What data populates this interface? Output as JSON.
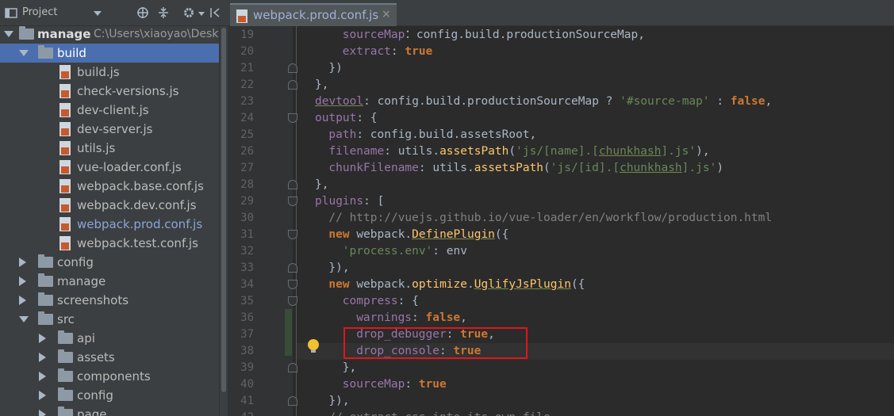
{
  "project_panel": {
    "title": "Project",
    "root": {
      "name": "manage",
      "path": "C:\\Users\\xiaoyao\\Deskt"
    },
    "tree": [
      {
        "label": "build",
        "type": "folder",
        "expanded": true,
        "depth": 1,
        "selected": true
      },
      {
        "label": "build.js",
        "type": "js",
        "depth": 2
      },
      {
        "label": "check-versions.js",
        "type": "js",
        "depth": 2
      },
      {
        "label": "dev-client.js",
        "type": "js",
        "depth": 2
      },
      {
        "label": "dev-server.js",
        "type": "js",
        "depth": 2
      },
      {
        "label": "utils.js",
        "type": "js",
        "depth": 2
      },
      {
        "label": "vue-loader.conf.js",
        "type": "js",
        "depth": 2
      },
      {
        "label": "webpack.base.conf.js",
        "type": "js",
        "depth": 2
      },
      {
        "label": "webpack.dev.conf.js",
        "type": "js",
        "depth": 2
      },
      {
        "label": "webpack.prod.conf.js",
        "type": "js",
        "depth": 2,
        "active": true
      },
      {
        "label": "webpack.test.conf.js",
        "type": "js",
        "depth": 2
      },
      {
        "label": "config",
        "type": "folder",
        "expanded": false,
        "depth": 1
      },
      {
        "label": "manage",
        "type": "folder",
        "expanded": false,
        "depth": 1
      },
      {
        "label": "screenshots",
        "type": "folder",
        "expanded": false,
        "depth": 1
      },
      {
        "label": "src",
        "type": "folder",
        "expanded": true,
        "depth": 1
      },
      {
        "label": "api",
        "type": "folder",
        "expanded": false,
        "depth": 2
      },
      {
        "label": "assets",
        "type": "folder",
        "expanded": false,
        "depth": 2
      },
      {
        "label": "components",
        "type": "folder",
        "expanded": false,
        "depth": 2
      },
      {
        "label": "config",
        "type": "folder",
        "expanded": false,
        "depth": 2
      },
      {
        "label": "page",
        "type": "folder",
        "expanded": false,
        "depth": 2
      }
    ]
  },
  "editor": {
    "tab": {
      "label": "webpack.prod.conf.js",
      "close": "×"
    },
    "lines": [
      {
        "n": "19",
        "indent": 4,
        "t": [
          [
            "p",
            "sourceMap"
          ],
          [
            "",
            "："
          ],
          [
            "",
            "config.build.productionSourceMap,"
          ]
        ]
      },
      {
        "n": "20",
        "indent": 4,
        "t": [
          [
            "p",
            "extract"
          ],
          [
            "",
            ": "
          ],
          [
            "k",
            "true"
          ]
        ]
      },
      {
        "n": "21",
        "indent": 2,
        "t": [
          [
            "",
            "})"
          ]
        ]
      },
      {
        "n": "22",
        "indent": 0,
        "t": [
          [
            "",
            "},"
          ]
        ]
      },
      {
        "n": "23",
        "indent": 0,
        "t": [
          [
            "pu",
            "devtool"
          ],
          [
            "",
            ": config.build.productionSourceMap ? "
          ],
          [
            "s",
            "'#source-map'"
          ],
          [
            "",
            " : "
          ],
          [
            "k",
            "false"
          ],
          [
            "",
            ","
          ]
        ]
      },
      {
        "n": "24",
        "indent": 0,
        "t": [
          [
            "p",
            "output"
          ],
          [
            "",
            ": {"
          ]
        ]
      },
      {
        "n": "25",
        "indent": 2,
        "t": [
          [
            "p",
            "path"
          ],
          [
            "",
            ": config.build.assetsRoot,"
          ]
        ]
      },
      {
        "n": "26",
        "indent": 2,
        "t": [
          [
            "p",
            "filename"
          ],
          [
            "",
            ": utils."
          ],
          [
            "f",
            "assetsPath"
          ],
          [
            "",
            "("
          ],
          [
            "s",
            "'js/[name].["
          ],
          [
            "su",
            "chunkhash"
          ],
          [
            "s",
            "].js'"
          ],
          [
            "",
            "),"
          ]
        ]
      },
      {
        "n": "27",
        "indent": 2,
        "t": [
          [
            "p",
            "chunkFilename"
          ],
          [
            "",
            ": utils."
          ],
          [
            "f",
            "assetsPath"
          ],
          [
            "",
            "("
          ],
          [
            "s",
            "'js/[id].["
          ],
          [
            "su",
            "chunkhash"
          ],
          [
            "s",
            "].js'"
          ],
          [
            "",
            ")"
          ]
        ]
      },
      {
        "n": "28",
        "indent": 0,
        "t": [
          [
            "",
            "},"
          ]
        ]
      },
      {
        "n": "29",
        "indent": 0,
        "t": [
          [
            "p",
            "plugins"
          ],
          [
            "",
            ": ["
          ]
        ]
      },
      {
        "n": "30",
        "indent": 2,
        "t": [
          [
            "c",
            "// http://vuejs.github.io/vue-loader/en/workflow/production.html"
          ]
        ]
      },
      {
        "n": "31",
        "indent": 2,
        "t": [
          [
            "k",
            "new "
          ],
          [
            "",
            "webpack."
          ],
          [
            "fu",
            "DefinePlugin"
          ],
          [
            "",
            "({"
          ]
        ]
      },
      {
        "n": "32",
        "indent": 4,
        "t": [
          [
            "s",
            "'process.env'"
          ],
          [
            "",
            ": env"
          ]
        ]
      },
      {
        "n": "33",
        "indent": 2,
        "t": [
          [
            "",
            "}),"
          ]
        ]
      },
      {
        "n": "34",
        "indent": 2,
        "t": [
          [
            "k",
            "new "
          ],
          [
            "",
            "webpack."
          ],
          [
            "f",
            "optimize"
          ],
          [
            "",
            "."
          ],
          [
            "fu",
            "UglifyJsPlugin"
          ],
          [
            "",
            "({"
          ]
        ]
      },
      {
        "n": "35",
        "indent": 4,
        "t": [
          [
            "p",
            "compress"
          ],
          [
            "",
            ": {"
          ]
        ]
      },
      {
        "n": "36",
        "indent": 6,
        "t": [
          [
            "p",
            "warnings"
          ],
          [
            "",
            ": "
          ],
          [
            "k",
            "false"
          ],
          [
            "",
            ","
          ]
        ]
      },
      {
        "n": "37",
        "indent": 6,
        "t": [
          [
            "p",
            "drop_debugger"
          ],
          [
            "",
            ": "
          ],
          [
            "k",
            "true"
          ],
          [
            "",
            ","
          ]
        ]
      },
      {
        "n": "38",
        "indent": 6,
        "t": [
          [
            "p",
            "drop_console"
          ],
          [
            "",
            ": "
          ],
          [
            "k",
            "true"
          ]
        ]
      },
      {
        "n": "39",
        "indent": 4,
        "t": [
          [
            "",
            "},"
          ]
        ]
      },
      {
        "n": "40",
        "indent": 4,
        "t": [
          [
            "p",
            "sourceMap"
          ],
          [
            "",
            ": "
          ],
          [
            "k",
            "true"
          ]
        ]
      },
      {
        "n": "41",
        "indent": 2,
        "t": [
          [
            "",
            "}),"
          ]
        ]
      },
      {
        "n": "42",
        "indent": 2,
        "t": [
          [
            "c",
            "// extract css into its own file"
          ]
        ]
      }
    ]
  },
  "colors": {
    "selection": "#4b6eaf",
    "highlight_box": "#e0161a",
    "keyword": "#cc7832",
    "property": "#9876aa",
    "string": "#6a8759",
    "function": "#ffc66d"
  }
}
